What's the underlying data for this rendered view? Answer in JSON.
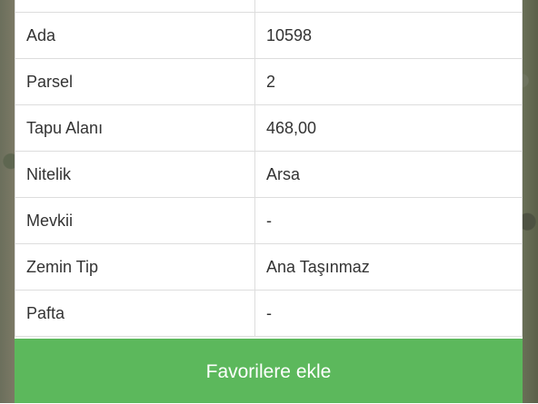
{
  "rows": [
    {
      "label": "",
      "value": ""
    },
    {
      "label": "Ada",
      "value": "10598"
    },
    {
      "label": "Parsel",
      "value": "2"
    },
    {
      "label": "Tapu Alanı",
      "value": "468,00"
    },
    {
      "label": "Nitelik",
      "value": "Arsa"
    },
    {
      "label": "Mevkii",
      "value": "-"
    },
    {
      "label": "Zemin Tip",
      "value": "Ana Taşınmaz"
    },
    {
      "label": "Pafta",
      "value": "-"
    }
  ],
  "favorite_button_label": "Favorilere ekle"
}
